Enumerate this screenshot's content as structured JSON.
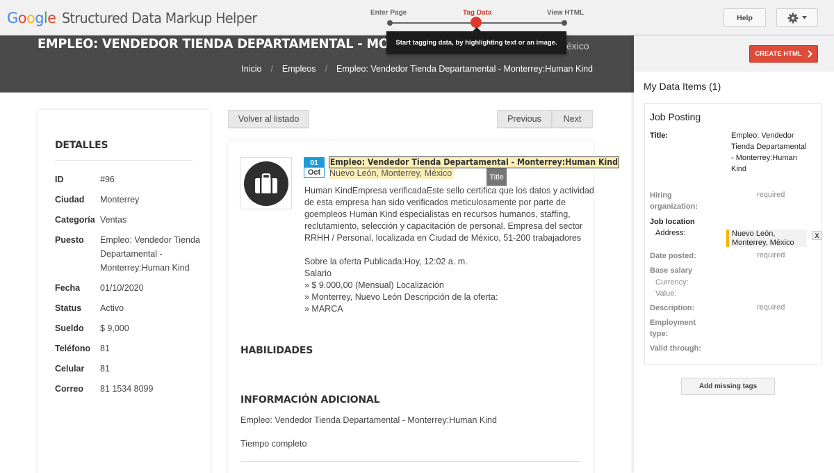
{
  "app": {
    "brand": "Google",
    "tool_name": "Structured Data Markup Helper",
    "brand_colors": [
      "#4285F4",
      "#EA4335",
      "#FBBC05",
      "#4285F4",
      "#34A853",
      "#EA4335"
    ]
  },
  "steps": [
    {
      "label": "Enter Page",
      "active": false
    },
    {
      "label": "Tag Data",
      "active": true
    },
    {
      "label": "View HTML",
      "active": false
    }
  ],
  "tooltip": "Start tagging data, by highlighting text or an image.",
  "toolbar": {
    "help_label": "Help",
    "settings_icon": "gear-icon",
    "accent": "#dd4b39"
  },
  "page": {
    "hero_title": "EMPLEO: VENDEDOR TIENDA DEPARTAMENTAL - MONTERREY",
    "hero_title_tail": "éxico",
    "breadcrumb": [
      "Inicio",
      "Empleos",
      "Empleo: Vendedor Tienda Departamental - Monterrey:Human Kind"
    ],
    "details": {
      "heading": "DETALLES",
      "rows": [
        {
          "key": "ID",
          "value": "#96"
        },
        {
          "key": "Ciudad",
          "value": "Monterrey"
        },
        {
          "key": "Categoría",
          "value": "Ventas"
        },
        {
          "key": "Puesto",
          "value": "Empleo: Vendedor Tienda Departamental - Monterrey:Human Kind"
        },
        {
          "key": "Fecha",
          "value": "01/10/2020"
        },
        {
          "key": "Status",
          "value": "Activo"
        },
        {
          "key": "Sueldo",
          "value": "$ 9,000"
        },
        {
          "key": "Teléfono",
          "value": "81"
        },
        {
          "key": "Celular",
          "value": "81"
        },
        {
          "key": "Correo",
          "value": "81 1534 8099"
        }
      ]
    },
    "back_label": "Volver al listado",
    "prev_label": "Previous",
    "next_label": "Next",
    "job": {
      "date_day": "01",
      "date_month": "Oct",
      "title": "Empleo: Vendedor Tienda Departamental - Monterrey:Human Kind",
      "location": "Nuevo León, Monterrey, México",
      "tag_tooltip": "Title",
      "description_lines": [
        "Human KindEmpresa verificadaEste sello certifica que los datos y actividad",
        "de esta empresa han sido verificados meticulosamente por parte de",
        "goempleos Human Kind especialistas en recursos humanos, staffing,",
        "reclutamiento, selección y capacitación de personal. Empresa del sector",
        "RRHH / Personal, localizada en Ciudad de México, 51-200 trabajadores",
        "",
        "Sobre la oferta Publicada:Hoy, 12:02 a. m.",
        "Salario",
        "» $ 9.000,00 (Mensual) Localización",
        "» Monterrey, Nuevo León Descripción de la oferta:",
        "» MARCA"
      ]
    },
    "skills_heading": "HABILIDADES",
    "extra_heading": "INFORMACIÓN ADICIONAL",
    "extra_line1": "Empleo: Vendedor Tienda Departamental - Monterrey:Human Kind",
    "extra_line2": "Tiempo completo"
  },
  "panel": {
    "create_label": "CREATE HTML",
    "heading": "My Data Items (1)",
    "item_type": "Job Posting",
    "title_label": "Title:",
    "title_value": "Empleo: Vendedor Tienda Departamental - Monterrey:Human Kind",
    "hiring_label": "Hiring organization:",
    "required_text": "required",
    "job_location_label": "Job location",
    "address_label": "Address:",
    "address_value": "Nuevo León, Monterrey, México",
    "remove_label": "X",
    "date_posted_label": "Date posted:",
    "base_salary_label": "Base salary",
    "currency_label": "Currency:",
    "value_label": "Value:",
    "description_label": "Description:",
    "employment_type_label": "Employment type:",
    "valid_through_label": "Valid through:",
    "add_missing_label": "Add missing tags",
    "highlight_color": "#f4b400"
  }
}
